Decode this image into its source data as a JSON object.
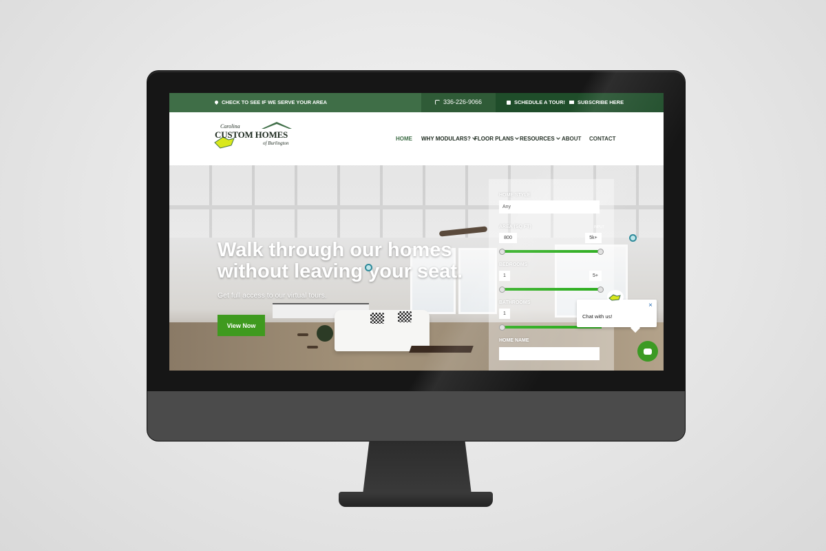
{
  "topbar": {
    "service_area": "CHECK TO SEE IF WE SERVE YOUR AREA",
    "phone": "336-226-9066",
    "schedule": "SCHEDULE A TOUR!",
    "subscribe": "SUBSCRIBE HERE"
  },
  "logo": {
    "line1": "Carolina",
    "line2": "CUSTOM HOMES",
    "line3": "of Burlington"
  },
  "nav": {
    "items": [
      "HOME",
      "WHY MODULARS?",
      "FLOOR PLANS",
      "RESOURCES",
      "ABOUT",
      "CONTACT"
    ]
  },
  "hero": {
    "title": "Walk through our homes without leaving your seat.",
    "subtitle": "Get full access to our virtual tours.",
    "cta": "View Now"
  },
  "filters": {
    "home_style_label": "HOME STYLE",
    "home_style_value": "Any",
    "area_label": "AREA (SQ FT)",
    "area_min": "800",
    "area_max": "5k+",
    "area_tag": "INPUT",
    "bedrooms_label": "BEDROOMS",
    "bedrooms_min": "1",
    "bedrooms_max": "5+",
    "bathrooms_label": "BATHROOMS",
    "bathrooms_min": "1",
    "home_name_label": "HOME NAME"
  },
  "chat": {
    "message": "Chat with us!",
    "close": "×"
  },
  "colors": {
    "brand_green": "#3f6e47",
    "accent_green": "#3f9a1f",
    "slider_green": "#2fae21"
  }
}
